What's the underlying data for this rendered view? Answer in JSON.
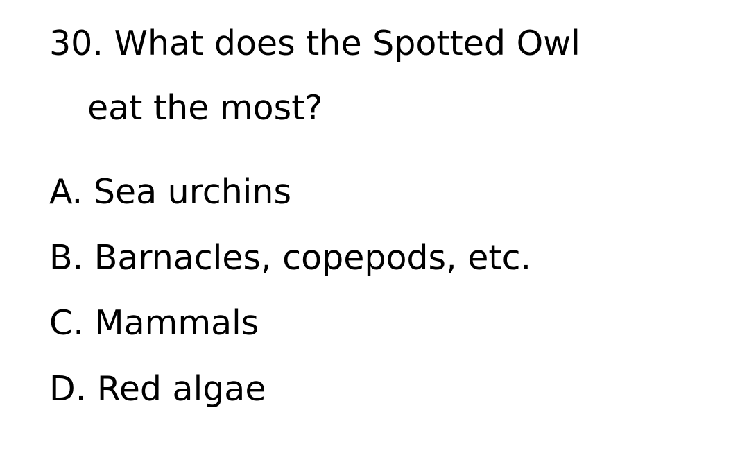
{
  "question": {
    "number": "30.",
    "line1": "What does the Spotted Owl",
    "line2": "eat the most?"
  },
  "options": [
    {
      "letter": "A.",
      "text": "Sea urchins"
    },
    {
      "letter": "B.",
      "text": "Barnacles, copepods, etc."
    },
    {
      "letter": "C.",
      "text": "Mammals"
    },
    {
      "letter": "D.",
      "text": "Red algae"
    }
  ]
}
